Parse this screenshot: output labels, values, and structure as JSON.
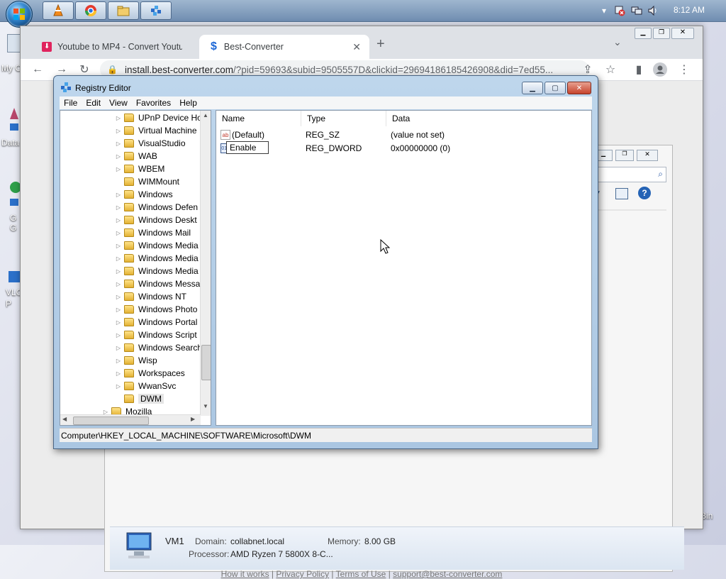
{
  "taskbar": {
    "clock": "8:12 AM",
    "pinned": [
      "vlc-icon",
      "chrome-icon",
      "file-explorer-icon",
      "registry-icon"
    ]
  },
  "desktop": {
    "icons": [
      "My C",
      "Data",
      "G G",
      "VLC P"
    ]
  },
  "browser": {
    "tabs": [
      {
        "label": "Youtube to MP4 - Convert Youtu"
      },
      {
        "label": "Best-Converter"
      }
    ],
    "url_prefix": "install.best-converter.com",
    "url_rest": "/?pid=59693&subid=9505557D&clickid=29694186185426908&did=7ed55..."
  },
  "page": {
    "system_info": {
      "machine": "VM1",
      "domain_label": "Domain:",
      "domain_value": "collabnet.local",
      "memory_label": "Memory:",
      "memory_value": "8.00 GB",
      "processor_label": "Processor:",
      "processor_value": "AMD Ryzen 7 5800X 8-C..."
    },
    "footer": {
      "links": [
        "How it works",
        "Privacy Policy",
        "Terms of Use",
        "support@best-converter.com"
      ],
      "separator": "|"
    },
    "right_edge_text": "Bin"
  },
  "regedit": {
    "title": "Registry Editor",
    "menu": [
      "File",
      "Edit",
      "View",
      "Favorites",
      "Help"
    ],
    "tree": [
      {
        "label": "UPnP Device Ho",
        "expander": "▷"
      },
      {
        "label": "Virtual Machine",
        "expander": "▷"
      },
      {
        "label": "VisualStudio",
        "expander": "▷"
      },
      {
        "label": "WAB",
        "expander": "▷"
      },
      {
        "label": "WBEM",
        "expander": "▷"
      },
      {
        "label": "WIMMount",
        "expander": ""
      },
      {
        "label": "Windows",
        "expander": "▷"
      },
      {
        "label": "Windows Defen",
        "expander": "▷"
      },
      {
        "label": "Windows Deskt",
        "expander": "▷"
      },
      {
        "label": "Windows Mail",
        "expander": "▷"
      },
      {
        "label": "Windows Media",
        "expander": "▷"
      },
      {
        "label": "Windows Media",
        "expander": "▷"
      },
      {
        "label": "Windows Media",
        "expander": "▷"
      },
      {
        "label": "Windows Messa",
        "expander": "▷"
      },
      {
        "label": "Windows NT",
        "expander": "▷"
      },
      {
        "label": "Windows Photo",
        "expander": "▷"
      },
      {
        "label": "Windows Portal",
        "expander": "▷"
      },
      {
        "label": "Windows Script",
        "expander": "▷"
      },
      {
        "label": "Windows Search",
        "expander": "▷"
      },
      {
        "label": "Wisp",
        "expander": "▷"
      },
      {
        "label": "Workspaces",
        "expander": "▷"
      },
      {
        "label": "WwanSvc",
        "expander": "▷"
      },
      {
        "label": "DWM",
        "expander": ""
      },
      {
        "label": "Mozilla",
        "expander": "▷"
      }
    ],
    "columns": [
      "Name",
      "Type",
      "Data"
    ],
    "values": [
      {
        "icon": "ab",
        "name": "(Default)",
        "type": "REG_SZ",
        "data": "(value not set)"
      },
      {
        "icon": "011",
        "name": "Enable",
        "type": "REG_DWORD",
        "data": "0x00000000 (0)"
      }
    ],
    "status_path": "Computer\\HKEY_LOCAL_MACHINE\\SOFTWARE\\Microsoft\\DWM"
  }
}
